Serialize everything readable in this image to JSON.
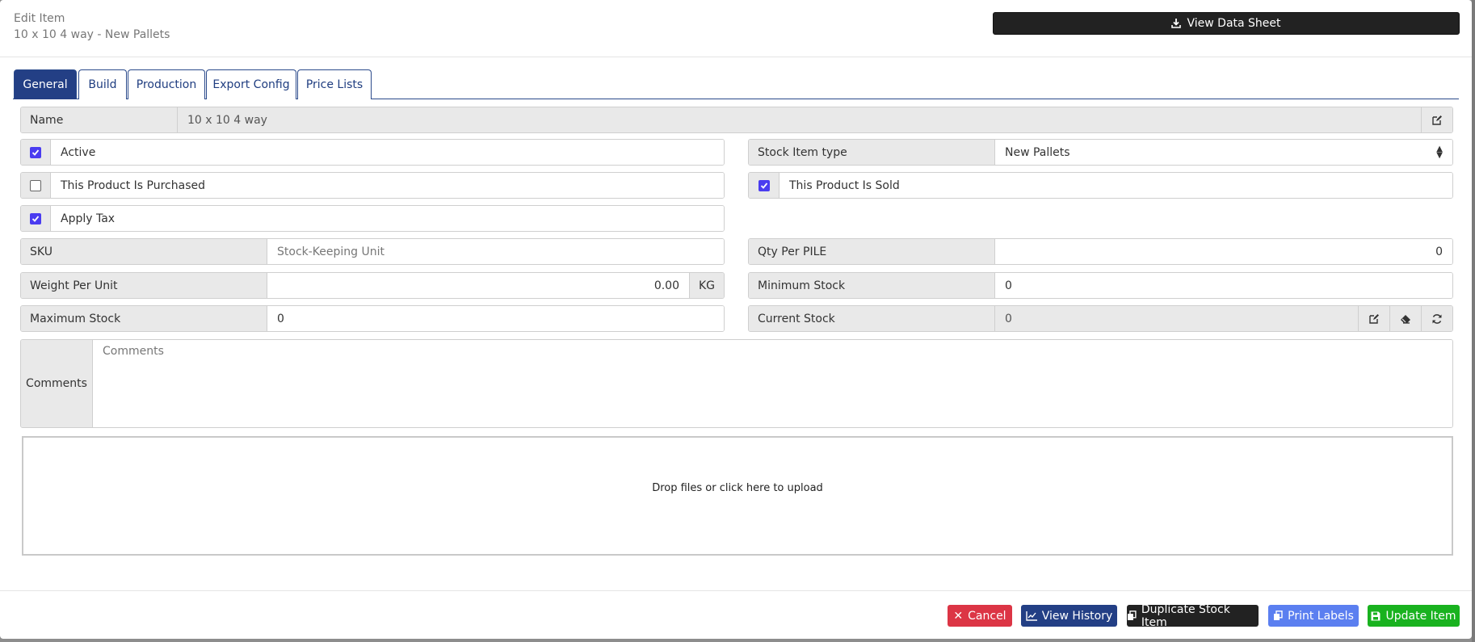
{
  "header": {
    "title": "Edit Item",
    "subtitle": "10 x 10 4 way - New Pallets",
    "datasheet_label": "View Data Sheet"
  },
  "tabs": [
    "General",
    "Build",
    "Production",
    "Export Config",
    "Price Lists"
  ],
  "name_row": {
    "label": "Name",
    "value": "10 x 10 4 way"
  },
  "checkboxes": {
    "active": {
      "label": "Active",
      "checked": true
    },
    "purchased": {
      "label": "This Product Is Purchased",
      "checked": false
    },
    "apply_tax": {
      "label": "Apply Tax",
      "checked": true
    },
    "sold": {
      "label": "This Product Is Sold",
      "checked": true
    }
  },
  "stock_item_type": {
    "label": "Stock Item type",
    "value": "New Pallets"
  },
  "sku": {
    "label": "SKU",
    "placeholder": "Stock-Keeping Unit"
  },
  "qty_per_pile": {
    "label": "Qty Per PILE",
    "value": "0"
  },
  "weight": {
    "label": "Weight Per Unit",
    "value": "0.00",
    "unit": "KG"
  },
  "min_stock": {
    "label": "Minimum Stock",
    "value": "0"
  },
  "max_stock": {
    "label": "Maximum Stock",
    "value": "0"
  },
  "current_stock": {
    "label": "Current Stock",
    "value": "0"
  },
  "comments": {
    "label": "Comments",
    "placeholder": "Comments"
  },
  "dropzone": {
    "text": "Drop files or click here to upload"
  },
  "footer": {
    "cancel": "Cancel",
    "history": "View History",
    "duplicate": "Duplicate Stock Item",
    "print": "Print Labels",
    "update": "Update Item"
  },
  "colors": {
    "tab_active": "#233f85",
    "checkbox": "#4a3cf0",
    "cancel": "#dc3545",
    "history": "#233f85",
    "duplicate": "#222222",
    "print": "#5b7ff0",
    "update": "#19b21f"
  }
}
